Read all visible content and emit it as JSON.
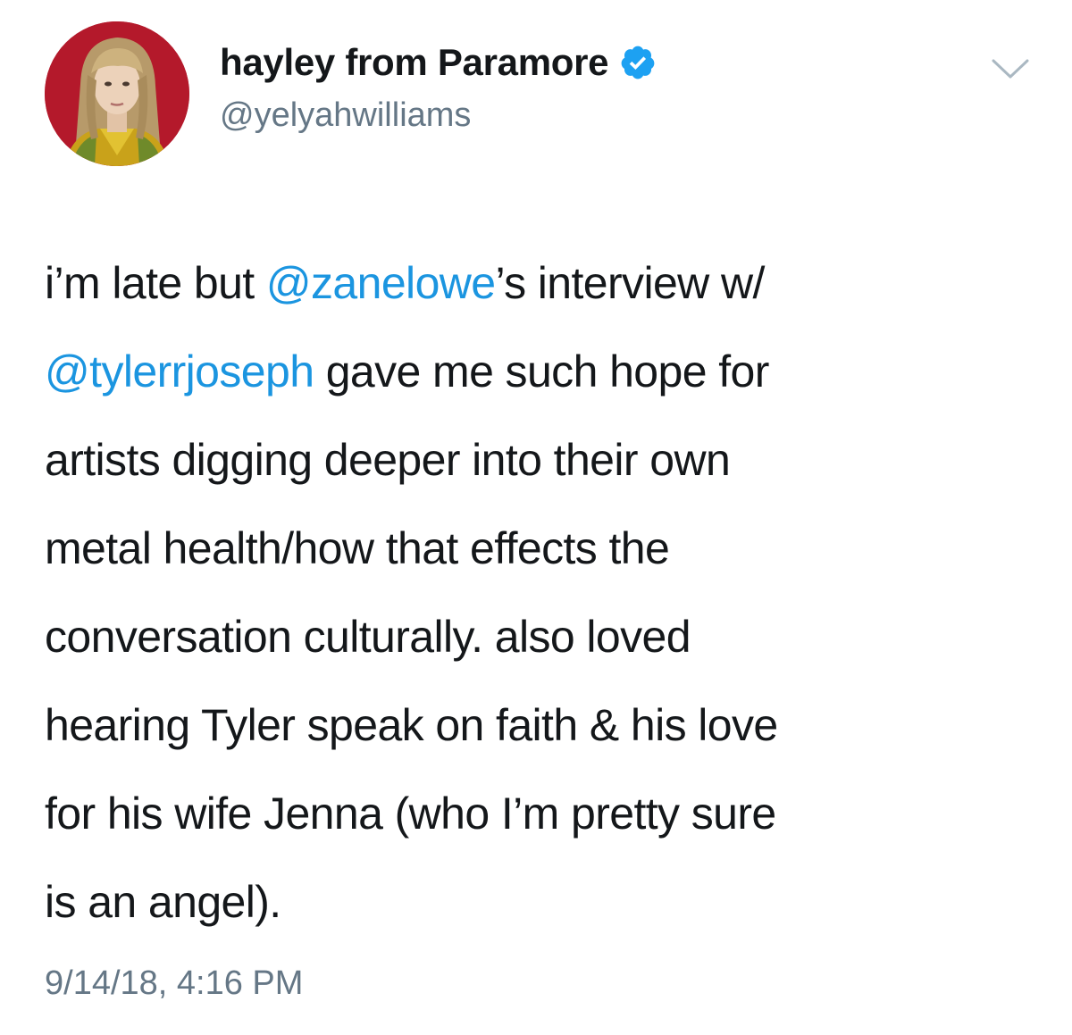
{
  "author": {
    "display_name": "hayley from Paramore",
    "handle": "@yelyahwilliams",
    "verified": true,
    "avatar_icon": "profile-photo",
    "verified_icon": "verified-badge-icon"
  },
  "menu": {
    "icon": "chevron-down-icon"
  },
  "tweet": {
    "lines": [
      {
        "pre": "i’m late but ",
        "mention": "@zanelowe",
        "post": "’s interview w/"
      },
      {
        "pre": "",
        "mention": "@tylerrjoseph",
        "post": " gave me such hope for"
      },
      {
        "pre": "artists digging deeper into their own",
        "mention": "",
        "post": ""
      },
      {
        "pre": "metal health/how that effects the",
        "mention": "",
        "post": ""
      },
      {
        "pre": "conversation culturally. also loved",
        "mention": "",
        "post": ""
      },
      {
        "pre": "hearing Tyler speak on faith & his love",
        "mention": "",
        "post": ""
      },
      {
        "pre": "for his wife Jenna (who I’m pretty sure",
        "mention": "",
        "post": ""
      },
      {
        "pre": "is an angel).",
        "mention": "",
        "post": ""
      }
    ],
    "timestamp": "9/14/18, 4:16 PM"
  },
  "colors": {
    "text": "#14171a",
    "secondary": "#657786",
    "link": "#1b95e0",
    "avatar_bg": "#b4192b"
  }
}
